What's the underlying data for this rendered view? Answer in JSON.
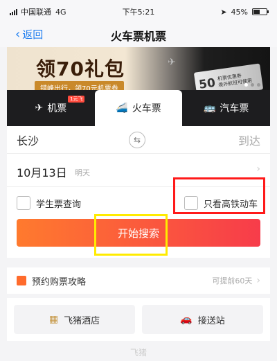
{
  "status": {
    "carrier": "中国联通",
    "network": "4G",
    "time": "下午5:21",
    "battery": "45%"
  },
  "nav": {
    "back_label": "返回",
    "title": "火车票机票"
  },
  "banner": {
    "title": "领70礼包",
    "subtitle": "错峰出行，领70元机票券",
    "coupon_amount": "50",
    "coupon_text_1": "机票优惠券",
    "coupon_text_2": "境外航班可使用"
  },
  "tabs": [
    {
      "label": "机票",
      "badge": "1元飞",
      "icon": "plane-icon"
    },
    {
      "label": "火车票",
      "icon": "train-icon"
    },
    {
      "label": "汽车票",
      "icon": "bus-icon"
    }
  ],
  "form": {
    "from_city": "长沙",
    "to_placeholder": "到达",
    "date": "10月13日",
    "weekday": "明天",
    "student_option": "学生票查询",
    "highspeed_option": "只看高铁动车",
    "search_label": "开始搜索"
  },
  "strategy": {
    "title": "预约购票攻略",
    "hint": "可提前60天"
  },
  "services": [
    {
      "label": "飞猪酒店",
      "icon": "hotel-icon"
    },
    {
      "label": "接送站",
      "icon": "car-icon"
    }
  ],
  "footer": {
    "brand": "飞猪"
  },
  "colors": {
    "accent_blue": "#1f7ef0",
    "search_gradient_start": "#ff7a2e",
    "search_gradient_end": "#f73c4a",
    "highlight_red": "#ff1a1a",
    "highlight_yellow": "#ffeb00"
  }
}
